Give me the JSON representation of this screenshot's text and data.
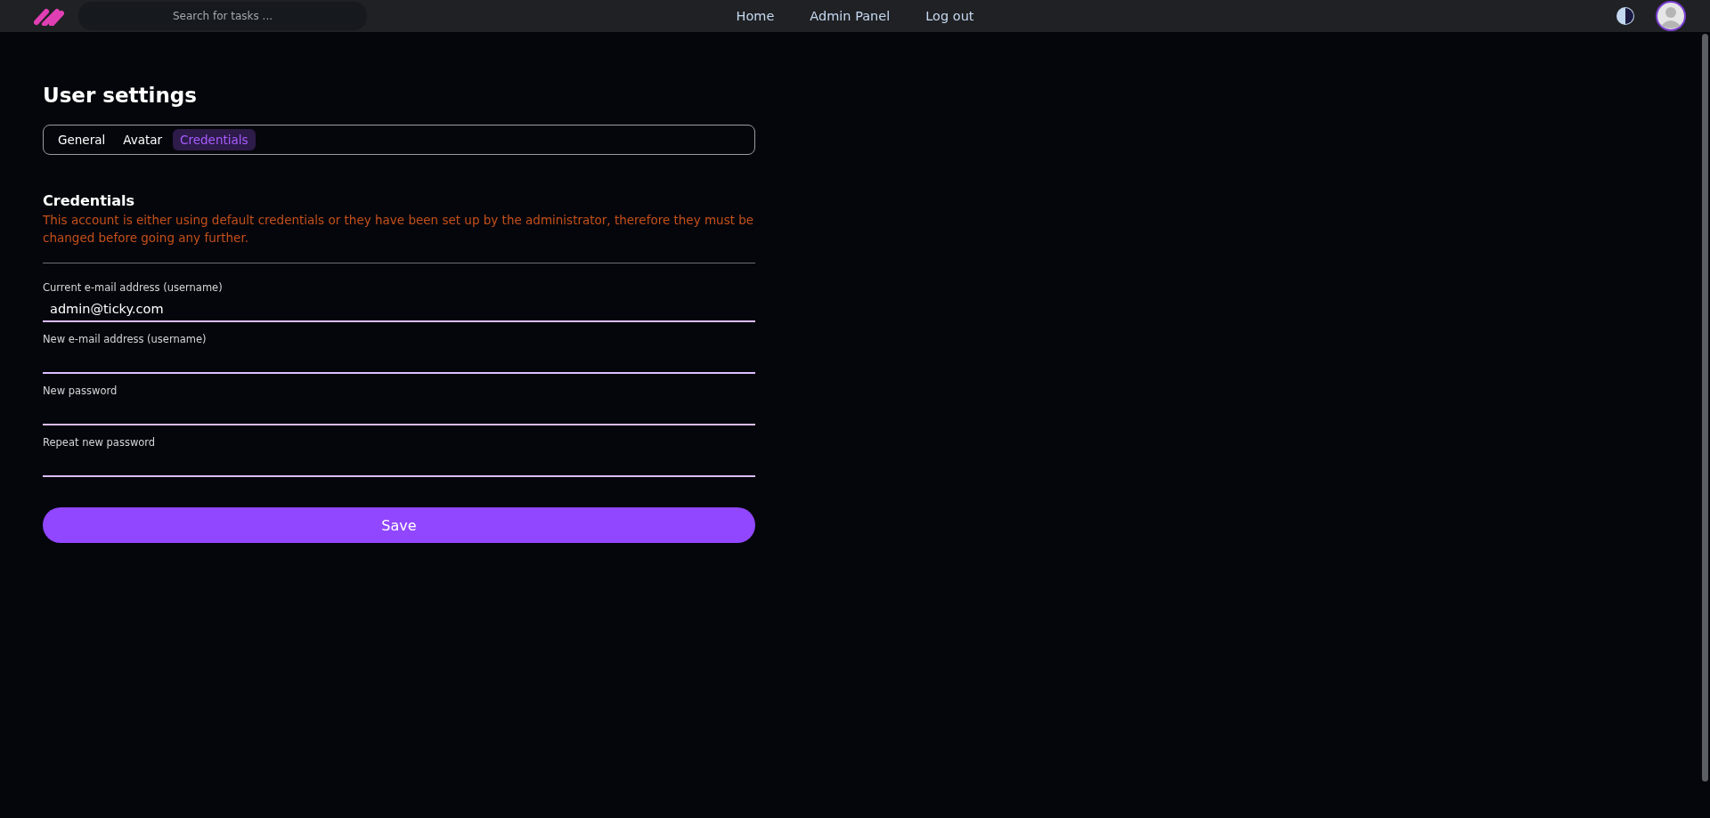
{
  "header": {
    "search": {
      "placeholder": "Search for tasks ..."
    },
    "nav": [
      {
        "label": "Home"
      },
      {
        "label": "Admin Panel"
      },
      {
        "label": "Log out"
      }
    ]
  },
  "page": {
    "title": "User settings",
    "tabs": [
      {
        "label": "General",
        "selected": false
      },
      {
        "label": "Avatar",
        "selected": false
      },
      {
        "label": "Credentials",
        "selected": true
      }
    ],
    "section": {
      "title": "Credentials",
      "warning": "This account is either using default credentials or they have been set up by the administrator, therefore they must be changed before going any further."
    },
    "fields": [
      {
        "label": "Current e-mail address (username)",
        "value": "admin@ticky.com"
      },
      {
        "label": "New e-mail address (username)"
      },
      {
        "label": "New password"
      },
      {
        "label": "Repeat new password"
      }
    ],
    "save_button": "Save"
  }
}
